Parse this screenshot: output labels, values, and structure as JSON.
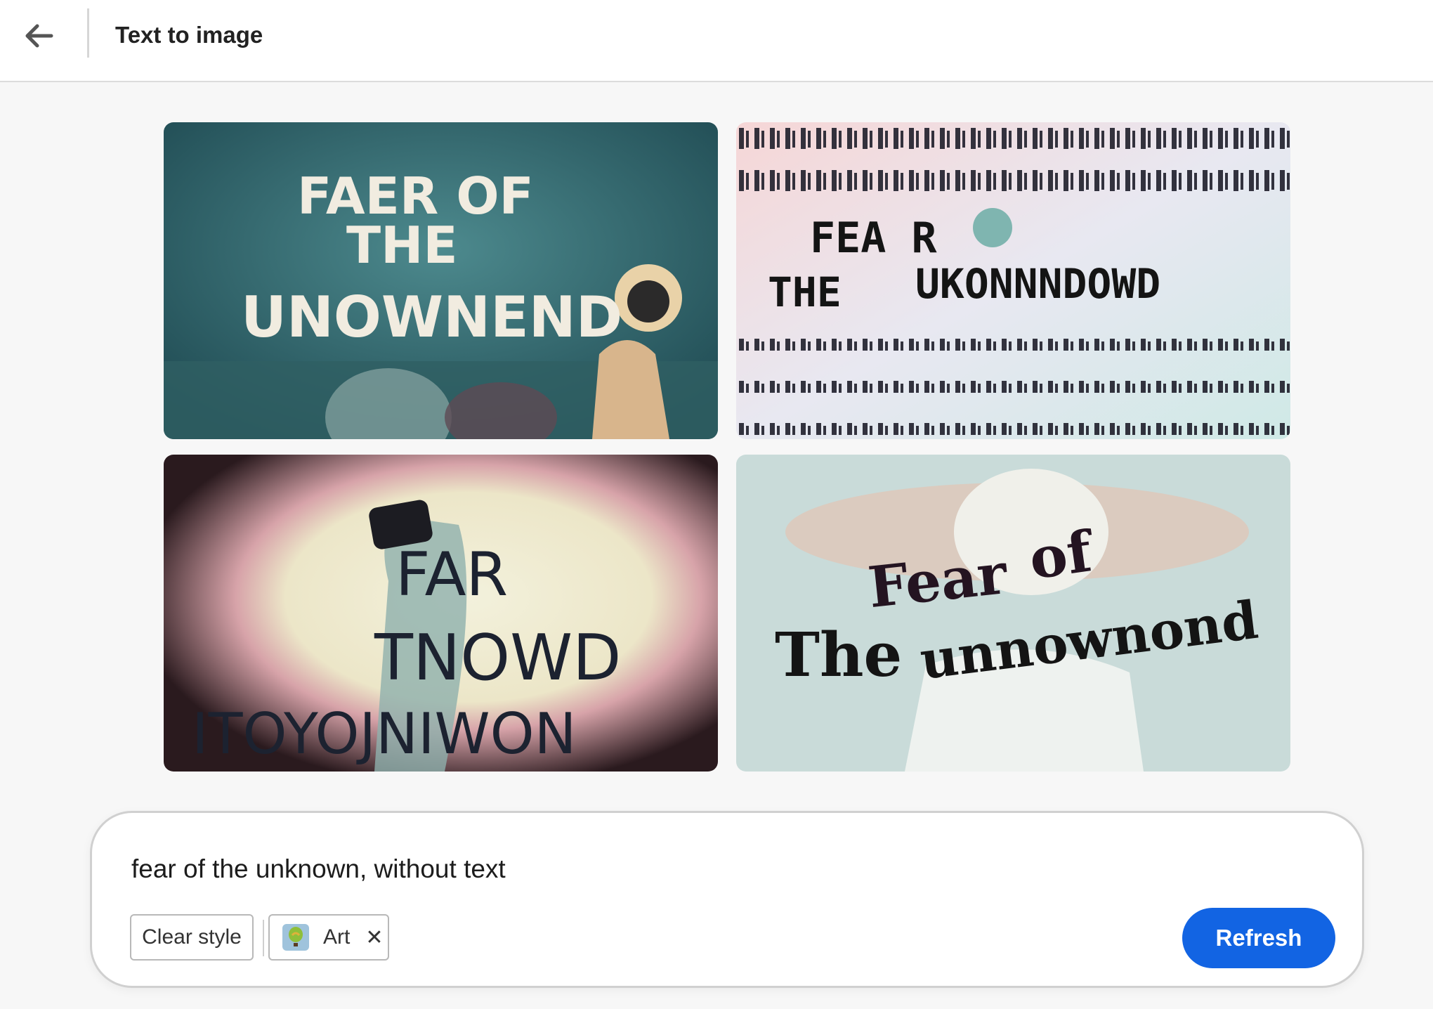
{
  "header": {
    "back_icon": "arrow-left-icon",
    "title": "Text to image"
  },
  "gallery": {
    "images": [
      {
        "lines": [
          "FAER OF",
          "THE",
          "UNOWNEND"
        ]
      },
      {
        "lines": [
          "FEA R",
          "THE",
          "UKONNNDOWD"
        ]
      },
      {
        "lines": [
          "FAR",
          "TNOWD",
          "ITOYOJNIWON"
        ]
      },
      {
        "lines": [
          "Fear",
          "of",
          "The",
          "unnownond"
        ]
      }
    ]
  },
  "prompt": {
    "text": "fear of the unknown, without text",
    "clear_style_label": "Clear style",
    "style_chip_label": "Art",
    "style_chip_icon": "hot-air-balloon-icon",
    "remove_icon": "close-icon",
    "refresh_label": "Refresh"
  },
  "colors": {
    "accent": "#1264e3",
    "background": "#f7f7f7"
  }
}
